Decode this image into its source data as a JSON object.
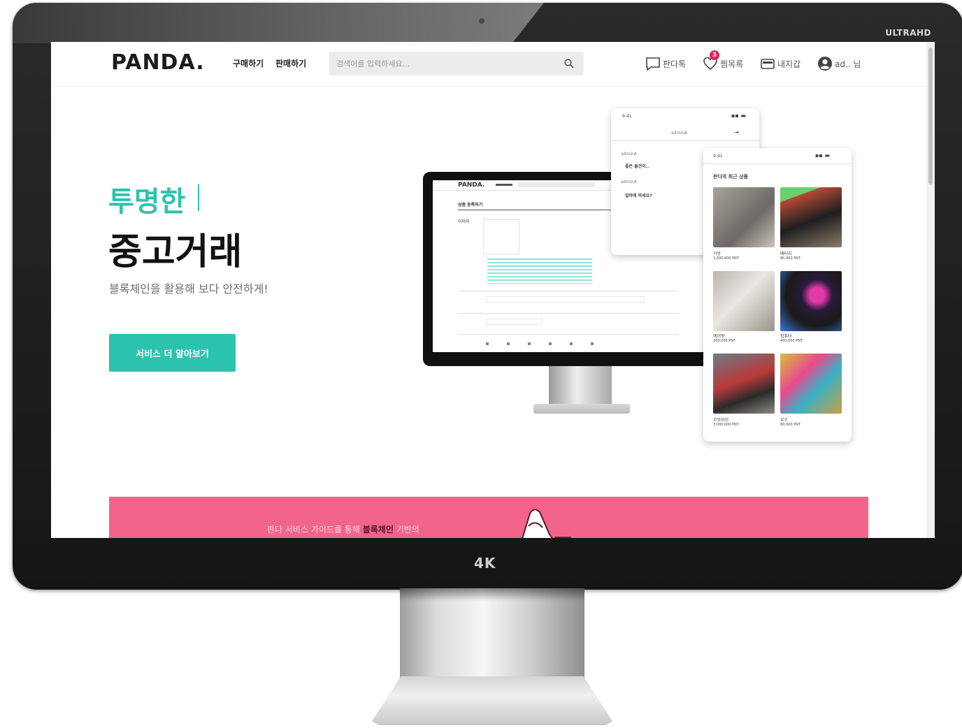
{
  "device": {
    "top_label": "ULTRAHD",
    "bottom_label": "4K"
  },
  "header": {
    "logo": "PANDA.",
    "nav": [
      "구매하기",
      "판매하기"
    ],
    "search_placeholder": "검색어를 입력하세요...",
    "util": {
      "talk_label": "판다톡",
      "wishlist_label": "찜목록",
      "wishlist_count": "3",
      "wallet_label": "내지갑",
      "user_label": "ad.. 님"
    }
  },
  "hero": {
    "accent": "투명한",
    "title": "중고거래",
    "subtitle": "블록체인을 활용해 보다 안전하게!",
    "cta_label": "서비스 더 알아보기"
  },
  "illustration": {
    "monitor_logo": "PANDA.",
    "monitor_heading": "상품 등록하기",
    "monitor_image_label": "이미지",
    "chat_title": "adminA",
    "chat_lines": [
      "adminA",
      "좋은 물건이..",
      "adminA",
      "얼마에 파세요?"
    ],
    "phone_heading": "판다의 최근 상품",
    "products": [
      {
        "name": "가방",
        "price": "1,000,000 PNT"
      },
      {
        "name": "배터리",
        "price": "80,000 PNT"
      },
      {
        "name": "에어팟",
        "price": "200,000 PNT"
      },
      {
        "name": "컴퓨터",
        "price": "400,000 PNT"
      },
      {
        "name": "오토바이",
        "price": "3,000,000 PNT"
      },
      {
        "name": "부츠",
        "price": "80,000 PNT"
      }
    ]
  },
  "banner": {
    "text_before": "판다 서비스 가이드를 통해",
    "highlight": "블록체인",
    "text_after": "기반의"
  },
  "colors": {
    "accent": "#2cc3ae",
    "banner": "#f2648a",
    "badge": "#e0245e"
  }
}
